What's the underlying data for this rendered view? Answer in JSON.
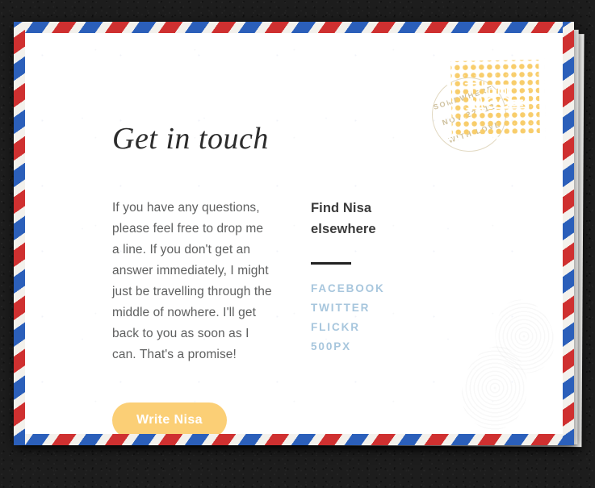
{
  "page": {
    "background_color": "#1d1d1d",
    "paper_color": "#ffffff"
  },
  "envelope": {
    "airmail_stripe_blue": "#2b5fba",
    "airmail_stripe_red": "#cf3030",
    "airmail_stripe_white": "#f3f1ec"
  },
  "stamp": {
    "name": "postage-stamp",
    "background_color": "#f8cd6b",
    "illustration": "boat-icon",
    "postmark": {
      "line1": "SOMEWHERE",
      "line2": "NOV 22 '12",
      "line3": "WITH LOVE"
    }
  },
  "main": {
    "title": "Get in touch",
    "body": "If you have any questions, please feel free to drop me a line. If you don't get an answer immediately, I might just be travelling through the middle of nowhere. I'll get back to you as soon as I can. That's a promise!",
    "cta_label": "Write Nisa",
    "cta_color": "#fbcf76"
  },
  "social": {
    "heading": "Find Nisa\nelsewhere",
    "link_color": "#a7c6dd",
    "links": [
      {
        "label": "FACEBOOK"
      },
      {
        "label": "TWITTER"
      },
      {
        "label": "FLICKR"
      },
      {
        "label": "500PX"
      }
    ]
  }
}
